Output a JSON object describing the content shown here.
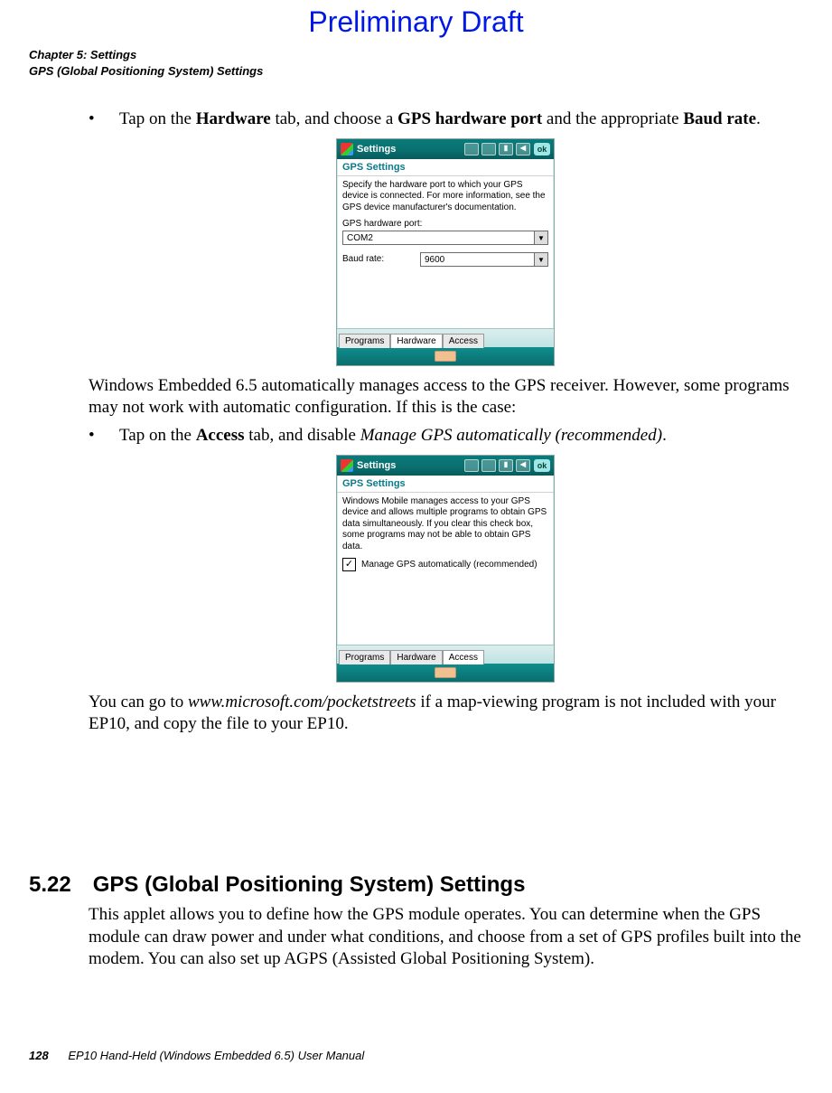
{
  "watermark": "Preliminary Draft",
  "running_head": {
    "line1": "Chapter 5: Settings",
    "line2": "GPS (Global Positioning System) Settings"
  },
  "bullet1": {
    "pre": "Tap on the ",
    "b1": "Hardware",
    "mid1": " tab, and choose a ",
    "b2": "GPS hardware port",
    "mid2": " and the appropriate ",
    "b3": "Baud rate",
    "post": "."
  },
  "shot1": {
    "title": "Settings",
    "ok": "ok",
    "subhead": "GPS Settings",
    "desc": "Specify the hardware port to which your GPS device is connected. For more information, see the GPS device manufacturer's documentation.",
    "port_label": "GPS hardware port:",
    "port_value": "COM2",
    "baud_label": "Baud rate:",
    "baud_value": "9600",
    "tabs": {
      "t1": "Programs",
      "t2": "Hardware",
      "t3": "Access"
    },
    "active_tab": "Hardware"
  },
  "para1": "Windows Embedded 6.5 automatically manages access to the GPS receiver. However, some programs may not work with automatic configuration. If this is the case:",
  "bullet2": {
    "pre": "Tap on the ",
    "b1": "Access",
    "mid": " tab, and disable ",
    "i1": "Manage GPS automatically (recommended)",
    "post": "."
  },
  "shot2": {
    "title": "Settings",
    "ok": "ok",
    "subhead": "GPS Settings",
    "desc": "Windows Mobile manages access to your GPS device and allows multiple programs to obtain GPS data simultaneously. If you clear this check box, some programs may not be able to obtain GPS data.",
    "check_label": "Manage GPS automatically (recommended)",
    "checked": "✓",
    "tabs": {
      "t1": "Programs",
      "t2": "Hardware",
      "t3": "Access"
    },
    "active_tab": "Access"
  },
  "para2": {
    "pre": "You can go to ",
    "i1": "www.microsoft.com/pocketstreets",
    "post": " if a map-viewing program is not included with your EP10, and copy the file to your EP10."
  },
  "section": {
    "num": "5.22",
    "title": "GPS (Global Positioning System) Settings",
    "para": "This applet allows you to define how the GPS module operates. You can determine when the GPS module can draw power and under what conditions, and choose from a set of GPS pro­files built into the modem. You can also set up AGPS (Assisted Global Positioning System)."
  },
  "footer": {
    "page": "128",
    "text": "EP10 Hand-Held (Windows Embedded 6.5) User Manual"
  }
}
